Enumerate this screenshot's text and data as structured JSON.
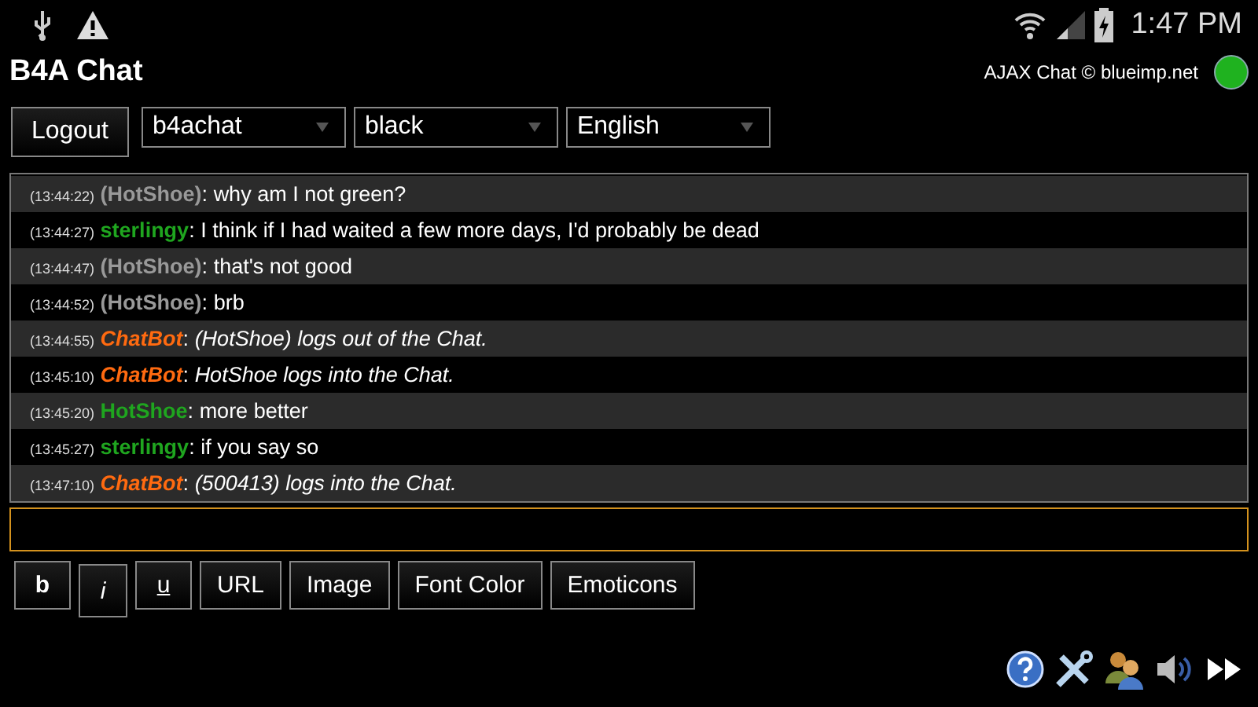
{
  "status_bar": {
    "time": "1:47 PM"
  },
  "header": {
    "title": "B4A Chat",
    "credit": "AJAX Chat © blueimp.net",
    "online": true
  },
  "toolbar": {
    "logout": "Logout",
    "selects": [
      {
        "value": "b4achat"
      },
      {
        "value": "black"
      },
      {
        "value": "English"
      }
    ]
  },
  "messages": [
    {
      "time": "(13:44:22)",
      "user": "(HotShoe)",
      "separator": ":",
      "kind": "offline",
      "text": "why am I not green?"
    },
    {
      "time": "(13:44:27)",
      "user": "sterlingy",
      "separator": ":",
      "kind": "online",
      "text": "I think if I had waited a few more days, I'd probably be dead"
    },
    {
      "time": "(13:44:47)",
      "user": "(HotShoe)",
      "separator": ":",
      "kind": "offline",
      "text": "that's not good"
    },
    {
      "time": "(13:44:52)",
      "user": "(HotShoe)",
      "separator": ":",
      "kind": "offline",
      "text": "brb"
    },
    {
      "time": "(13:44:55)",
      "user": "ChatBot",
      "separator": ":",
      "kind": "bot",
      "text": "(HotShoe) logs out of the Chat."
    },
    {
      "time": "(13:45:10)",
      "user": "ChatBot",
      "separator": ":",
      "kind": "bot",
      "text": "HotShoe logs into the Chat."
    },
    {
      "time": "(13:45:20)",
      "user": "HotShoe",
      "separator": ":",
      "kind": "online",
      "text": "more better"
    },
    {
      "time": "(13:45:27)",
      "user": "sterlingy",
      "separator": ":",
      "kind": "online",
      "text": "if you say so"
    },
    {
      "time": "(13:47:10)",
      "user": "ChatBot",
      "separator": ":",
      "kind": "bot",
      "text": "(500413) logs into the Chat."
    }
  ],
  "format_buttons": [
    {
      "label": "b",
      "kind": "bold"
    },
    {
      "label": "i",
      "kind": "italic"
    },
    {
      "label": "u",
      "kind": "underline"
    },
    {
      "label": "URL",
      "kind": "plain"
    },
    {
      "label": "Image",
      "kind": "plain"
    },
    {
      "label": "Font Color",
      "kind": "plain"
    },
    {
      "label": "Emoticons",
      "kind": "plain"
    }
  ]
}
